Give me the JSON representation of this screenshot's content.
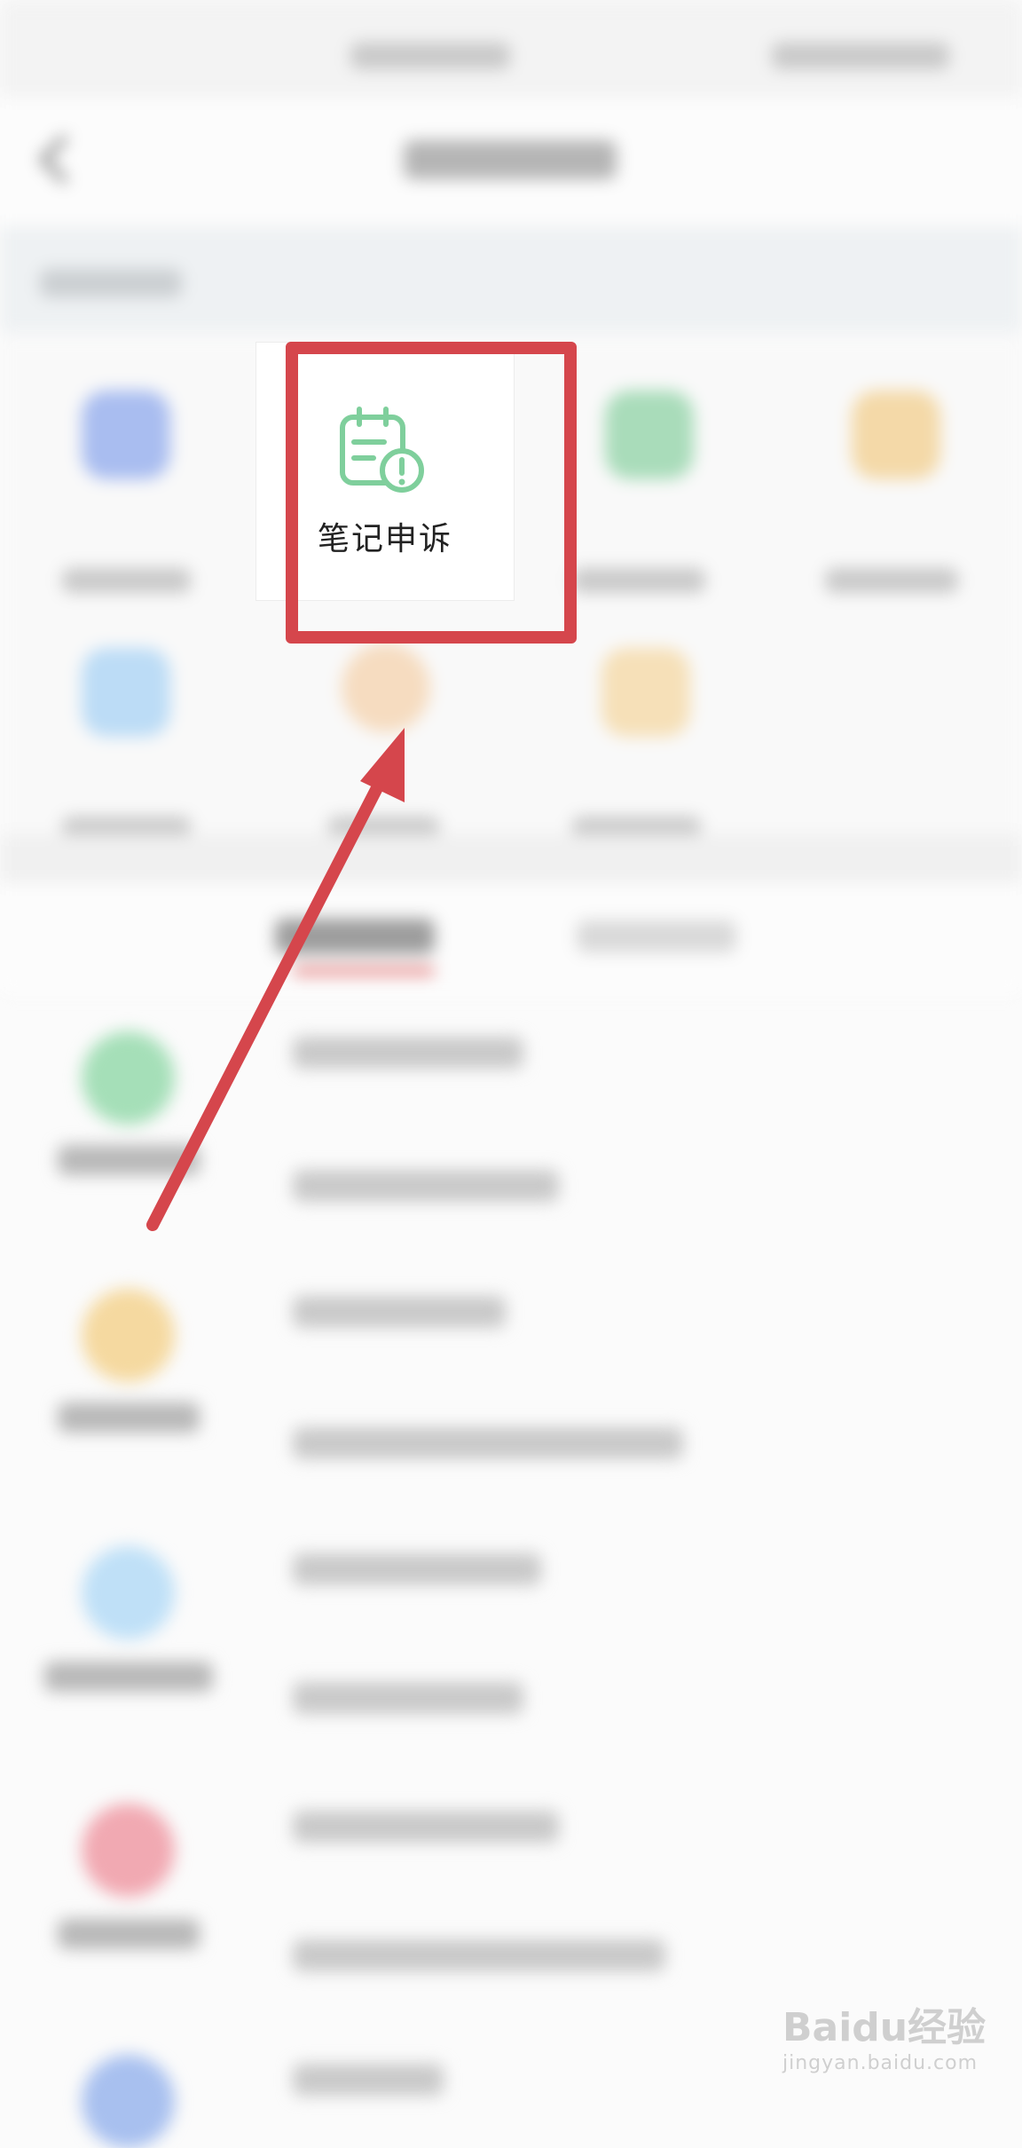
{
  "note_appeal": {
    "label": "笔记申诉"
  },
  "watermark": {
    "brand": "Baidu经验",
    "domain": "jingyan.baidu.com"
  },
  "colors": {
    "annotation_red": "#d5464c",
    "icon_green": "#7fcf9c"
  }
}
